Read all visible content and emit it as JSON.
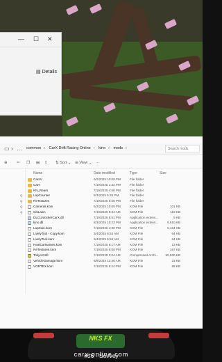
{
  "mini_window": {
    "details_label": "Details",
    "controls": [
      "—",
      "☐",
      "✕"
    ]
  },
  "explorer": {
    "breadcrumb": [
      "common",
      "CarX Drift Racing Online",
      "kino",
      "mods"
    ],
    "search_placeholder": "Search mods",
    "toolbar": {
      "sort_label": "Sort",
      "view_label": "View"
    },
    "columns": {
      "name": "Name",
      "date": "Date modified",
      "type": "Type",
      "size": "Size"
    },
    "files": [
      {
        "name": "CarsV",
        "date": "6/2/2025 10:09 PM",
        "type": "File folder",
        "size": "",
        "icon": "folder"
      },
      {
        "name": "Cars",
        "date": "7/19/2025 1:32 PM",
        "type": "File folder",
        "size": "",
        "icon": "folder"
      },
      {
        "name": "KN_Rears",
        "date": "7/19/2025 4:58 PM",
        "type": "File folder",
        "size": "",
        "icon": "folder"
      },
      {
        "name": "LapCounter",
        "date": "8/3/2025 5:28 PM",
        "type": "File folder",
        "size": "",
        "icon": "folder"
      },
      {
        "name": "ReTextures",
        "date": "7/19/2025 5:08 PM",
        "type": "File folder",
        "size": "",
        "icon": "folder"
      },
      {
        "name": "Camerali.kom",
        "date": "6/2/2025 10:08 PM",
        "type": "KOM File",
        "size": "101 KB",
        "icon": "file"
      },
      {
        "name": "CitiLawn",
        "date": "7/19/2025 8:34 AM",
        "type": "KOM File",
        "size": "119 KB",
        "icon": "file"
      },
      {
        "name": "DLCUnlockerCarX.dll",
        "date": "7/19/2025 5:51 PM",
        "type": "Application extens...",
        "size": "5 KB",
        "icon": "dll"
      },
      {
        "name": "kino.dll",
        "date": "8/3/2025 10:23 PM",
        "type": "Application extens...",
        "size": "6,610 KB",
        "icon": "dll"
      },
      {
        "name": "LapCalc.kom",
        "date": "7/19/2025 4:30 PM",
        "type": "KOM File",
        "size": "6,164 KB",
        "icon": "file"
      },
      {
        "name": "LivelyTool - Copy.kom",
        "date": "3/4/2025 6:53 AM",
        "type": "KOM File",
        "size": "64 KB",
        "icon": "file"
      },
      {
        "name": "LivelyTool.kom",
        "date": "3/4/2025 6:53 AM",
        "type": "KOM File",
        "size": "64 KB",
        "icon": "file"
      },
      {
        "name": "RealCarNames.kom",
        "date": "7/19/2025 6:17 AM",
        "type": "KOM File",
        "size": "13 KB",
        "icon": "file"
      },
      {
        "name": "ReTextures.kom",
        "date": "7/19/2025 8:06 PM",
        "type": "KOM File",
        "size": "167 KB",
        "icon": "file"
      },
      {
        "name": "Tokyo Drift",
        "date": "7/19/2025 3:04 AM",
        "type": "Compressed Archi...",
        "size": "90,930 KB",
        "icon": "zip"
      },
      {
        "name": "VehicleDamage.kom",
        "date": "6/9/2025 12:46 AM",
        "type": "KOM File",
        "size": "23 KB",
        "icon": "file"
      },
      {
        "name": "VORTEX.kom",
        "date": "7/19/2025 8:24 PM",
        "type": "KOM File",
        "size": "89 KB",
        "icon": "file"
      }
    ]
  },
  "banner": {
    "logo": "NKS FX",
    "site": "carx-online.com"
  },
  "caption": "#56 -    Sovvey"
}
